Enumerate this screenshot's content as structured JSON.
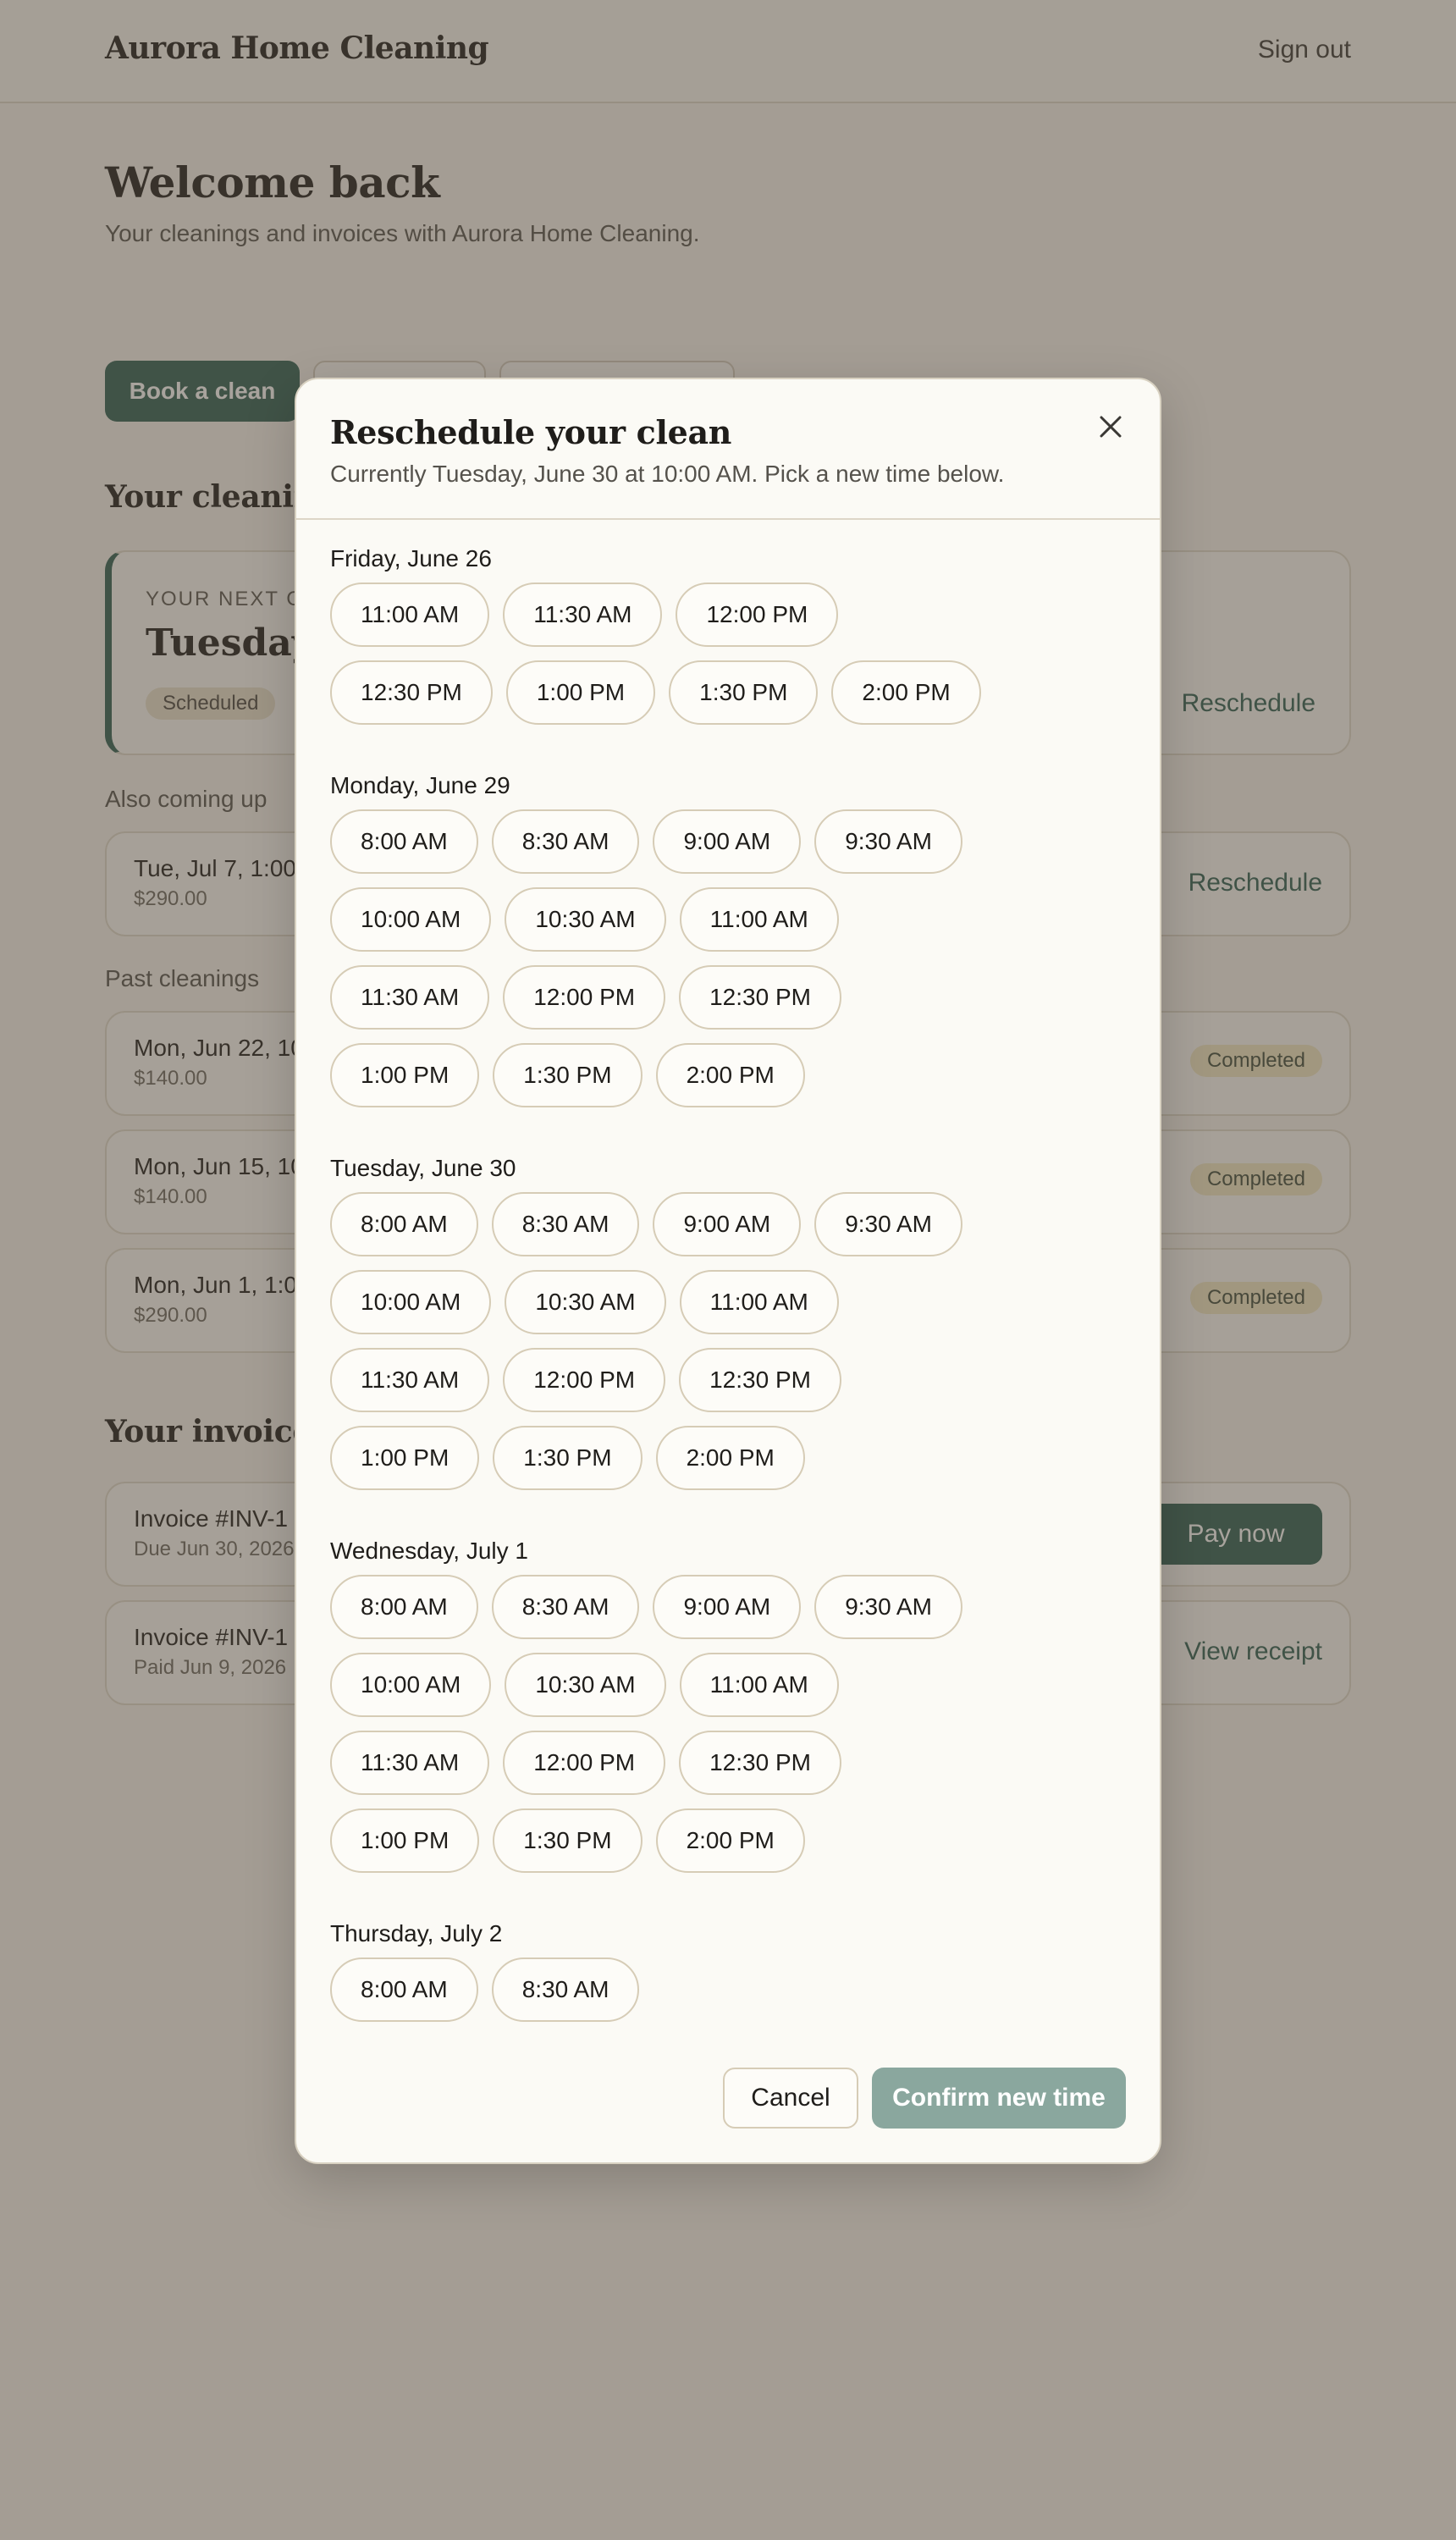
{
  "header": {
    "brand": "Aurora Home Cleaning",
    "sign_out": "Sign out"
  },
  "welcome": {
    "title": "Welcome back",
    "subtitle": "Your cleanings and invoices with Aurora Home Cleaning."
  },
  "actions": {
    "book": "Book a clean"
  },
  "cleanings": {
    "title": "Your cleaning",
    "next": {
      "label": "YOUR NEXT CL",
      "date": "Tuesday, J",
      "status": "Scheduled",
      "action": "Reschedule"
    },
    "also_title": "Also coming up",
    "also": [
      {
        "title": "Tue, Jul 7, 1:00",
        "amount": "$290.00",
        "action": "Reschedule"
      }
    ],
    "past_title": "Past cleanings",
    "past": [
      {
        "title": "Mon, Jun 22, 10",
        "amount": "$140.00",
        "status": "Completed"
      },
      {
        "title": "Mon, Jun 15, 10",
        "amount": "$140.00",
        "status": "Completed"
      },
      {
        "title": "Mon, Jun 1, 1:0",
        "amount": "$290.00",
        "status": "Completed"
      }
    ]
  },
  "invoices": {
    "title": "Your invoices",
    "items": [
      {
        "title": "Invoice #INV-1",
        "sub": "Due Jun 30, 2026",
        "action": "Pay now"
      },
      {
        "title": "Invoice #INV-1",
        "sub": "Paid Jun 9, 2026",
        "action": "View receipt"
      }
    ]
  },
  "modal": {
    "title": "Reschedule your clean",
    "subtitle": "Currently Tuesday, June 30 at 10:00 AM. Pick a new time below.",
    "days": [
      {
        "label": "Friday, June 26",
        "slots": [
          "11:00 AM",
          "11:30 AM",
          "12:00 PM",
          "12:30 PM",
          "1:00 PM",
          "1:30 PM",
          "2:00 PM"
        ]
      },
      {
        "label": "Monday, June 29",
        "slots": [
          "8:00 AM",
          "8:30 AM",
          "9:00 AM",
          "9:30 AM",
          "10:00 AM",
          "10:30 AM",
          "11:00 AM",
          "11:30 AM",
          "12:00 PM",
          "12:30 PM",
          "1:00 PM",
          "1:30 PM",
          "2:00 PM"
        ]
      },
      {
        "label": "Tuesday, June 30",
        "slots": [
          "8:00 AM",
          "8:30 AM",
          "9:00 AM",
          "9:30 AM",
          "10:00 AM",
          "10:30 AM",
          "11:00 AM",
          "11:30 AM",
          "12:00 PM",
          "12:30 PM",
          "1:00 PM",
          "1:30 PM",
          "2:00 PM"
        ]
      },
      {
        "label": "Wednesday, July 1",
        "slots": [
          "8:00 AM",
          "8:30 AM",
          "9:00 AM",
          "9:30 AM",
          "10:00 AM",
          "10:30 AM",
          "11:00 AM",
          "11:30 AM",
          "12:00 PM",
          "12:30 PM",
          "1:00 PM",
          "1:30 PM",
          "2:00 PM"
        ]
      },
      {
        "label": "Thursday, July 2",
        "slots": [
          "8:00 AM",
          "8:30 AM"
        ]
      }
    ],
    "cancel": "Cancel",
    "confirm": "Confirm new time"
  }
}
